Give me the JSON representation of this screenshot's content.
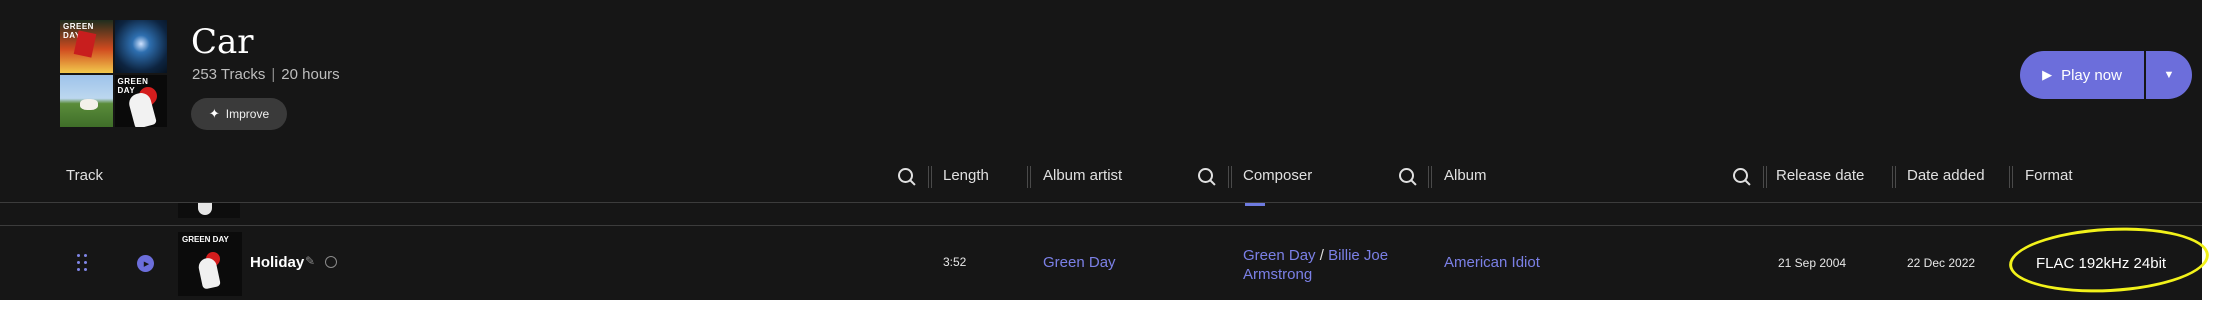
{
  "playlist": {
    "title": "Car",
    "track_count": "253 Tracks",
    "duration": "20 hours",
    "cover_labels": [
      "GREEN DAY",
      "",
      "",
      "GREEN DAY"
    ]
  },
  "actions": {
    "improve_label": "Improve",
    "play_now_label": "Play now",
    "sparkle_icon": "sparkle-icon",
    "play_icon": "play-icon",
    "dropdown_icon": "chevron-down-icon"
  },
  "columns": {
    "track": "Track",
    "length": "Length",
    "album_artist": "Album artist",
    "composer": "Composer",
    "album": "Album",
    "release_date": "Release date",
    "date_added": "Date added",
    "format": "Format"
  },
  "track": {
    "title": "Holiday",
    "length": "3:52",
    "album_artist": "Green Day",
    "composer_1": "Green Day",
    "composer_separator": "/",
    "composer_2": "Billie Joe Armstrong",
    "album": "American Idiot",
    "release_date": "21 Sep 2004",
    "date_added": "22 Dec 2022",
    "format": "FLAC 192kHz 24bit",
    "thumb_label": "GREEN DAY"
  },
  "colors": {
    "accent": "#6c6edb",
    "link": "#7b80e6",
    "background": "#161616",
    "highlight": "#f2f21a"
  }
}
